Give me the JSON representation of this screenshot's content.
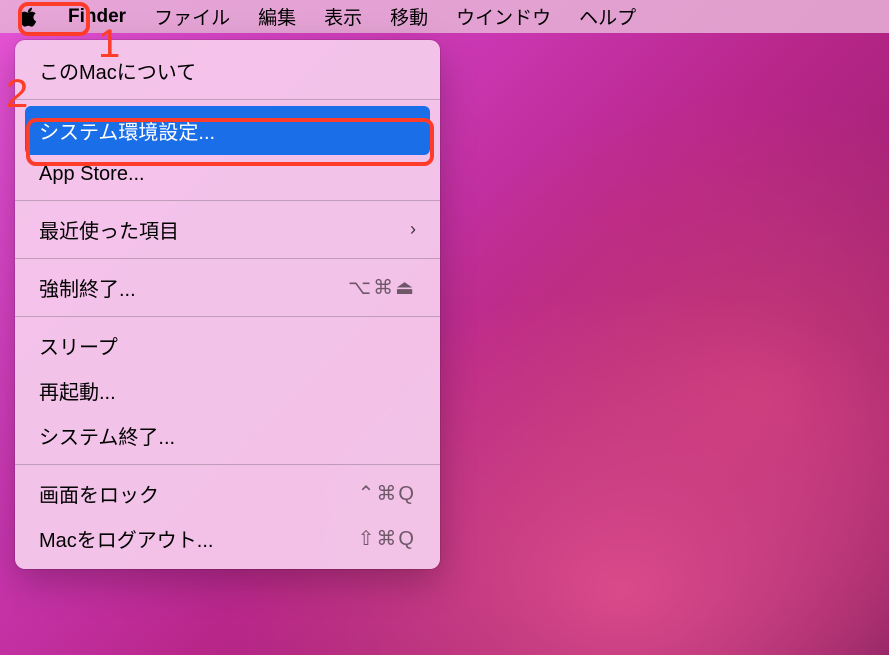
{
  "menubar": {
    "finder": "Finder",
    "file": "ファイル",
    "edit": "編集",
    "view": "表示",
    "go": "移動",
    "window": "ウインドウ",
    "help": "ヘルプ"
  },
  "dropdown": {
    "about": "このMacについて",
    "system_prefs": "システム環境設定...",
    "app_store": "App Store...",
    "recent_items": "最近使った項目",
    "force_quit": "強制終了...",
    "force_quit_shortcut": "⌥⌘⏏",
    "sleep": "スリープ",
    "restart": "再起動...",
    "shutdown": "システム終了...",
    "lock_screen": "画面をロック",
    "lock_screen_shortcut": "⌃⌘Q",
    "logout": "Macをログアウト...",
    "logout_shortcut": "⇧⌘Q"
  },
  "annotations": {
    "num1": "1",
    "num2": "2"
  }
}
